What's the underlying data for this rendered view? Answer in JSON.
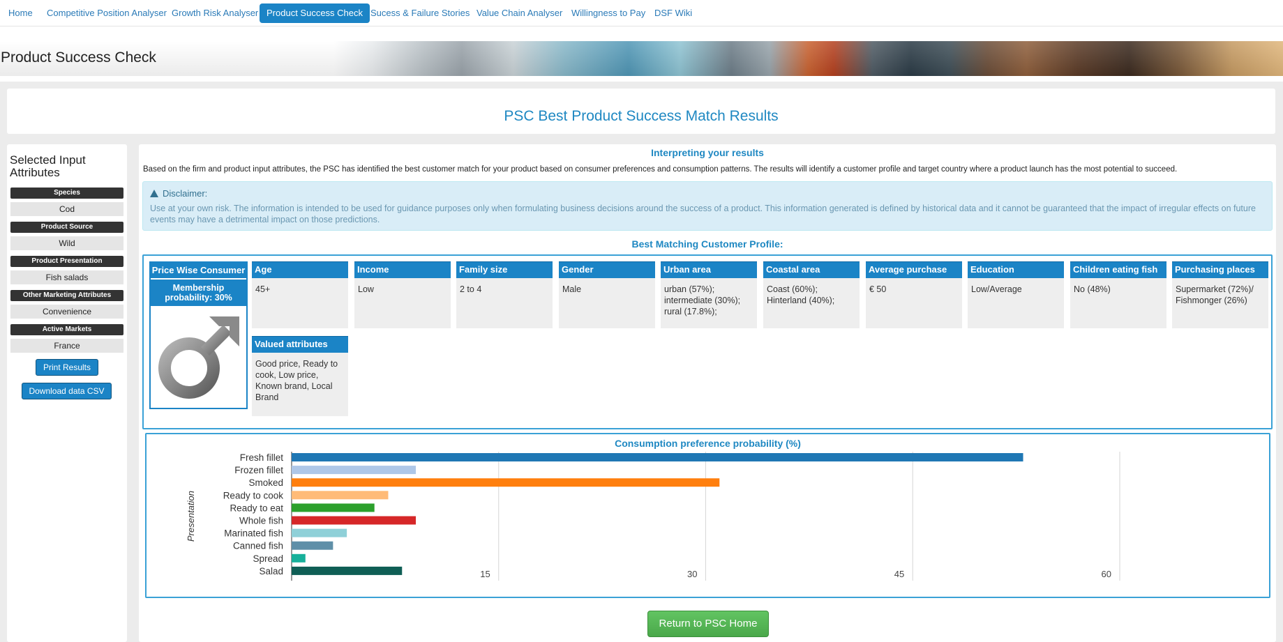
{
  "nav": {
    "items": [
      {
        "label": "Home"
      },
      {
        "label": "Competitive Position Analyser"
      },
      {
        "label": "Growth Risk Analyser"
      },
      {
        "label": "Product Success Check"
      },
      {
        "label": "Sucess & Failure Stories"
      },
      {
        "label": "Value Chain Analyser"
      },
      {
        "label": "Willingness to Pay"
      },
      {
        "label": "DSF Wiki"
      }
    ],
    "active_index": 3
  },
  "banner": {
    "title": "Product Success Check"
  },
  "results_header": {
    "title": "PSC Best Product Success Match Results"
  },
  "sidebar": {
    "title": "Selected Input Attributes",
    "sections": [
      {
        "label": "Species",
        "value": "Cod"
      },
      {
        "label": "Product Source",
        "value": "Wild"
      },
      {
        "label": "Product Presentation",
        "value": "Fish salads"
      },
      {
        "label": "Other Marketing Attributes",
        "value": "Convenience"
      },
      {
        "label": "Active Markets",
        "value": "France"
      }
    ],
    "print_label": "Print Results",
    "download_label": "Download data CSV"
  },
  "interpreting": {
    "title": "Interpreting your results",
    "text": "Based on the firm and product input attributes, the PSC has identified the best customer match for your product based on consumer preferences and consumption patterns. The results will identify a customer profile and target country where a product launch has the most potential to succeed."
  },
  "disclaimer": {
    "title": "Disclaimer:",
    "text": "Use at your own risk. The information is intended to be used for guidance purposes only when formulating business decisions around the success of a product. This information generated is defined by historical data and it cannot be guaranteed that the impact of irregular effects on future events may have a detrimental impact on those predictions."
  },
  "profile": {
    "title": "Best Matching Customer Profile:",
    "consumer": {
      "name": "Price Wise Consumer",
      "membership": "Membership probability: 30%",
      "icon": "male-symbol-icon"
    },
    "attributes": [
      {
        "label": "Age",
        "value": "45+"
      },
      {
        "label": "Income",
        "value": "Low"
      },
      {
        "label": "Family size",
        "value": "2 to 4"
      },
      {
        "label": "Gender",
        "value": "Male"
      },
      {
        "label": "Urban area",
        "value": "urban (57%); intermediate (30%); rural (17.8%);"
      },
      {
        "label": "Coastal area",
        "value": "Coast (60%); Hinterland (40%);"
      },
      {
        "label": "Average purchase",
        "value": "€ 50"
      },
      {
        "label": "Education",
        "value": "Low/Average"
      },
      {
        "label": "Children eating fish",
        "value": "No (48%)"
      },
      {
        "label": "Purchasing places",
        "value": "Supermarket (72%)/ Fishmonger (26%)"
      }
    ],
    "valued": {
      "label": "Valued attributes",
      "value": "Good price, Ready to cook, Low price, Known brand, Local Brand"
    }
  },
  "chart_data": {
    "type": "bar",
    "orientation": "horizontal",
    "title": "Consumption preference probability (%)",
    "ylabel": "Presentation",
    "xlabel": "",
    "categories": [
      "Fresh fillet",
      "Frozen fillet",
      "Smoked",
      "Ready to cook",
      "Ready to eat",
      "Whole fish",
      "Marinated fish",
      "Canned fish",
      "Spread",
      "Salad"
    ],
    "values": [
      53,
      9,
      31,
      7,
      6,
      9,
      4,
      3,
      1,
      8
    ],
    "colors": [
      "#1f77b4",
      "#aec7e8",
      "#ff7f0e",
      "#ffbb78",
      "#2ca02c",
      "#d62728",
      "#8fd0d8",
      "#5f8fa8",
      "#17b09a",
      "#0f5e55"
    ],
    "xticks": [
      15,
      30,
      45,
      60
    ],
    "xlim": [
      0,
      60
    ],
    "grid": true,
    "legend": "none"
  },
  "return_label": "Return to PSC Home"
}
